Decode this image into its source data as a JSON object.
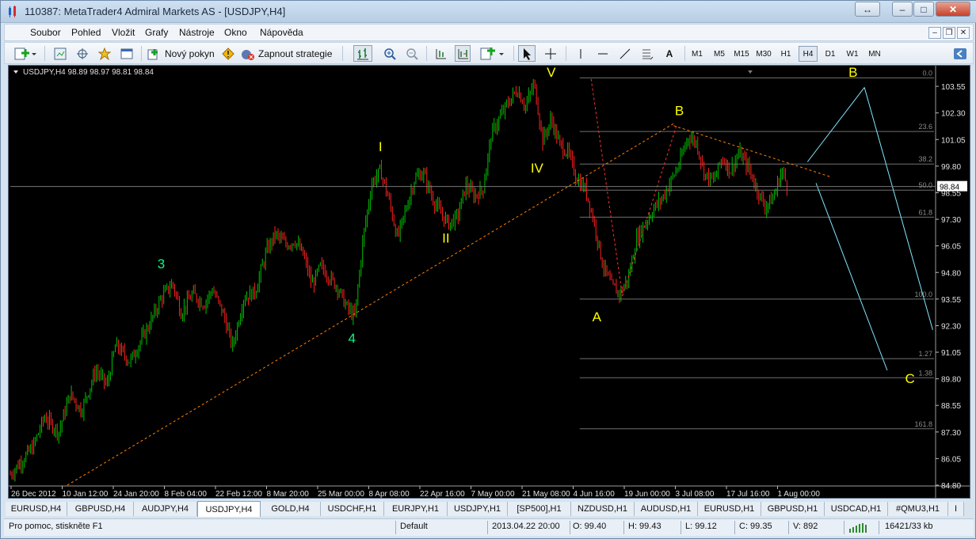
{
  "window": {
    "title": "110387: MetaTrader4 Admiral Markets AS - [USDJPY,H4]",
    "restore_glyph": "↔",
    "min_glyph": "–",
    "max_glyph": "□",
    "close_glyph": "✕"
  },
  "menu": {
    "items": [
      "Soubor",
      "Pohled",
      "Vložit",
      "Grafy",
      "Nástroje",
      "Okno",
      "Nápověda"
    ],
    "mdi": {
      "min": "–",
      "restore": "❐",
      "close": "✕"
    }
  },
  "toolbar": {
    "new_order": "Nový pokyn",
    "strategy": "Zapnout strategie",
    "text_tool": "A",
    "timeframes": [
      "M1",
      "M5",
      "M15",
      "M30",
      "H1",
      "H4",
      "D1",
      "W1",
      "MN"
    ],
    "active_timeframe": "H4"
  },
  "chart_info": {
    "header": "USDJPY,H4  98.89 98.97 98.81 98.84",
    "bid_label": "98.84"
  },
  "chart_data": {
    "type": "candlestick",
    "symbol": "USDJPY",
    "timeframe": "H4",
    "ylim": [
      84.8,
      104.0
    ],
    "price_ticks": [
      "103.55",
      "102.30",
      "101.05",
      "99.80",
      "98.55",
      "97.30",
      "96.05",
      "94.80",
      "93.55",
      "92.30",
      "91.05",
      "89.80",
      "88.55",
      "87.30",
      "86.05",
      "84.80"
    ],
    "time_ticks": [
      "26 Dec 2012",
      "10 Jan 12:00",
      "24 Jan 20:00",
      "8 Feb 04:00",
      "22 Feb 12:00",
      "8 Mar 20:00",
      "25 Mar 00:00",
      "8 Apr 08:00",
      "22 Apr 16:00",
      "7 May 00:00",
      "21 May 08:00",
      "4 Jun 16:00",
      "19 Jun 00:00",
      "3 Jul 08:00",
      "17 Jul 16:00",
      "1 Aug 00:00"
    ],
    "close_path": [
      {
        "x": 0.0,
        "y": 85.3
      },
      {
        "x": 0.8,
        "y": 86.6
      },
      {
        "x": 1.2,
        "y": 88.0
      },
      {
        "x": 1.7,
        "y": 87.3
      },
      {
        "x": 2.1,
        "y": 89.1
      },
      {
        "x": 2.5,
        "y": 88.3
      },
      {
        "x": 3.0,
        "y": 90.2
      },
      {
        "x": 3.4,
        "y": 89.5
      },
      {
        "x": 3.7,
        "y": 91.4
      },
      {
        "x": 4.2,
        "y": 90.6
      },
      {
        "x": 4.9,
        "y": 92.4
      },
      {
        "x": 5.3,
        "y": 93.6
      },
      {
        "x": 5.7,
        "y": 94.3
      },
      {
        "x": 6.0,
        "y": 92.9
      },
      {
        "x": 6.4,
        "y": 93.8
      },
      {
        "x": 6.8,
        "y": 93.3
      },
      {
        "x": 7.1,
        "y": 94.0
      },
      {
        "x": 7.5,
        "y": 92.8
      },
      {
        "x": 7.8,
        "y": 91.3
      },
      {
        "x": 8.2,
        "y": 93.6
      },
      {
        "x": 8.6,
        "y": 93.9
      },
      {
        "x": 9.0,
        "y": 95.8
      },
      {
        "x": 9.3,
        "y": 96.6
      },
      {
        "x": 9.7,
        "y": 96.1
      },
      {
        "x": 10.0,
        "y": 96.3
      },
      {
        "x": 10.3,
        "y": 95.6
      },
      {
        "x": 10.6,
        "y": 94.2
      },
      {
        "x": 10.9,
        "y": 95.1
      },
      {
        "x": 11.2,
        "y": 94.6
      },
      {
        "x": 11.5,
        "y": 94.1
      },
      {
        "x": 11.8,
        "y": 93.2
      },
      {
        "x": 12.1,
        "y": 92.7
      },
      {
        "x": 12.4,
        "y": 96.5
      },
      {
        "x": 12.7,
        "y": 99.0
      },
      {
        "x": 13.0,
        "y": 99.6
      },
      {
        "x": 13.3,
        "y": 98.2
      },
      {
        "x": 13.6,
        "y": 96.4
      },
      {
        "x": 13.9,
        "y": 97.8
      },
      {
        "x": 14.2,
        "y": 99.2
      },
      {
        "x": 14.5,
        "y": 99.5
      },
      {
        "x": 14.8,
        "y": 98.4
      },
      {
        "x": 15.1,
        "y": 97.6
      },
      {
        "x": 15.4,
        "y": 97.1
      },
      {
        "x": 15.7,
        "y": 97.4
      },
      {
        "x": 16.0,
        "y": 98.9
      },
      {
        "x": 16.3,
        "y": 98.4
      },
      {
        "x": 16.6,
        "y": 98.7
      },
      {
        "x": 16.9,
        "y": 101.3
      },
      {
        "x": 17.2,
        "y": 102.1
      },
      {
        "x": 17.5,
        "y": 102.8
      },
      {
        "x": 17.8,
        "y": 103.4
      },
      {
        "x": 18.1,
        "y": 102.6
      },
      {
        "x": 18.4,
        "y": 103.7
      },
      {
        "x": 18.7,
        "y": 101.0
      },
      {
        "x": 19.0,
        "y": 102.0
      },
      {
        "x": 19.3,
        "y": 100.8
      },
      {
        "x": 19.6,
        "y": 100.4
      },
      {
        "x": 19.9,
        "y": 99.2
      },
      {
        "x": 20.2,
        "y": 98.7
      },
      {
        "x": 20.5,
        "y": 97.2
      },
      {
        "x": 20.8,
        "y": 95.2
      },
      {
        "x": 21.1,
        "y": 94.2
      },
      {
        "x": 21.4,
        "y": 93.8
      },
      {
        "x": 21.7,
        "y": 94.5
      },
      {
        "x": 22.0,
        "y": 96.4
      },
      {
        "x": 22.3,
        "y": 97.1
      },
      {
        "x": 22.6,
        "y": 97.8
      },
      {
        "x": 22.9,
        "y": 98.3
      },
      {
        "x": 23.2,
        "y": 99.1
      },
      {
        "x": 23.5,
        "y": 99.9
      },
      {
        "x": 23.8,
        "y": 101.2
      },
      {
        "x": 24.1,
        "y": 100.9
      },
      {
        "x": 24.4,
        "y": 99.4
      },
      {
        "x": 24.7,
        "y": 99.1
      },
      {
        "x": 25.0,
        "y": 100.2
      },
      {
        "x": 25.3,
        "y": 99.6
      },
      {
        "x": 25.6,
        "y": 100.4
      },
      {
        "x": 25.9,
        "y": 99.8
      },
      {
        "x": 26.2,
        "y": 98.8
      },
      {
        "x": 26.5,
        "y": 97.9
      },
      {
        "x": 26.8,
        "y": 98.3
      },
      {
        "x": 27.1,
        "y": 99.6
      },
      {
        "x": 27.3,
        "y": 98.84
      }
    ],
    "fib_levels": [
      {
        "label": "0.0",
        "value": 103.95
      },
      {
        "label": "23.6",
        "value": 101.43
      },
      {
        "label": "38.2",
        "value": 99.9
      },
      {
        "label": "50.0",
        "value": 98.67
      },
      {
        "label": "61.8",
        "value": 97.4
      },
      {
        "label": "100.0",
        "value": 93.55
      },
      {
        "label": "1.27",
        "value": 90.75
      },
      {
        "label": "1.38",
        "value": 89.85
      },
      {
        "label": "161.8",
        "value": 87.45
      }
    ],
    "wave_labels": [
      {
        "text": "3",
        "x": 5.3,
        "y": 95.0,
        "color": "#00ff80"
      },
      {
        "text": "4",
        "x": 12.0,
        "y": 91.5,
        "color": "#00ff80"
      },
      {
        "text": "I",
        "x": 13.0,
        "y": 100.5,
        "color": "#ffff00"
      },
      {
        "text": "II",
        "x": 15.3,
        "y": 96.2,
        "color": "#ffff00"
      },
      {
        "text": "V",
        "x": 19.0,
        "y": 104.0,
        "color": "#ffff00"
      },
      {
        "text": "IV",
        "x": 18.5,
        "y": 99.5,
        "color": "#ffff00"
      },
      {
        "text": "A",
        "x": 20.6,
        "y": 92.5,
        "color": "#ffff00"
      },
      {
        "text": "B",
        "x": 23.5,
        "y": 102.2,
        "color": "#ffff00"
      },
      {
        "text": "B",
        "x": 29.6,
        "y": 104.0,
        "color": "#ffff00"
      },
      {
        "text": "C",
        "x": 31.6,
        "y": 89.6,
        "color": "#ffff00"
      }
    ]
  },
  "tabs": [
    "EURUSD,H4",
    "GBPUSD,H4",
    "AUDJPY,H4",
    "USDJPY,H4",
    "GOLD,H4",
    "USDCHF,H1",
    "EURJPY,H1",
    "USDJPY,H1",
    "[SP500],H1",
    "NZDUSD,H1",
    "AUDUSD,H1",
    "EURUSD,H1",
    "GBPUSD,H1",
    "USDCAD,H1",
    "#QMU3,H1",
    "I"
  ],
  "active_tab": "USDJPY,H4",
  "status": {
    "help": "Pro pomoc, stiskněte F1",
    "profile": "Default",
    "datetime": "2013.04.22 20:00",
    "open": "O: 99.40",
    "high": "H: 99.43",
    "low": "L: 99.12",
    "close": "C: 99.35",
    "volume": "V: 892",
    "traffic": "16421/33 kb"
  },
  "colors": {
    "bull": "#00c000",
    "bear": "#ff2020",
    "fib": "#707070",
    "trend_orange": "#ff8000",
    "trend_red": "#ff3030",
    "projection_cyan": "#80e8ff"
  }
}
